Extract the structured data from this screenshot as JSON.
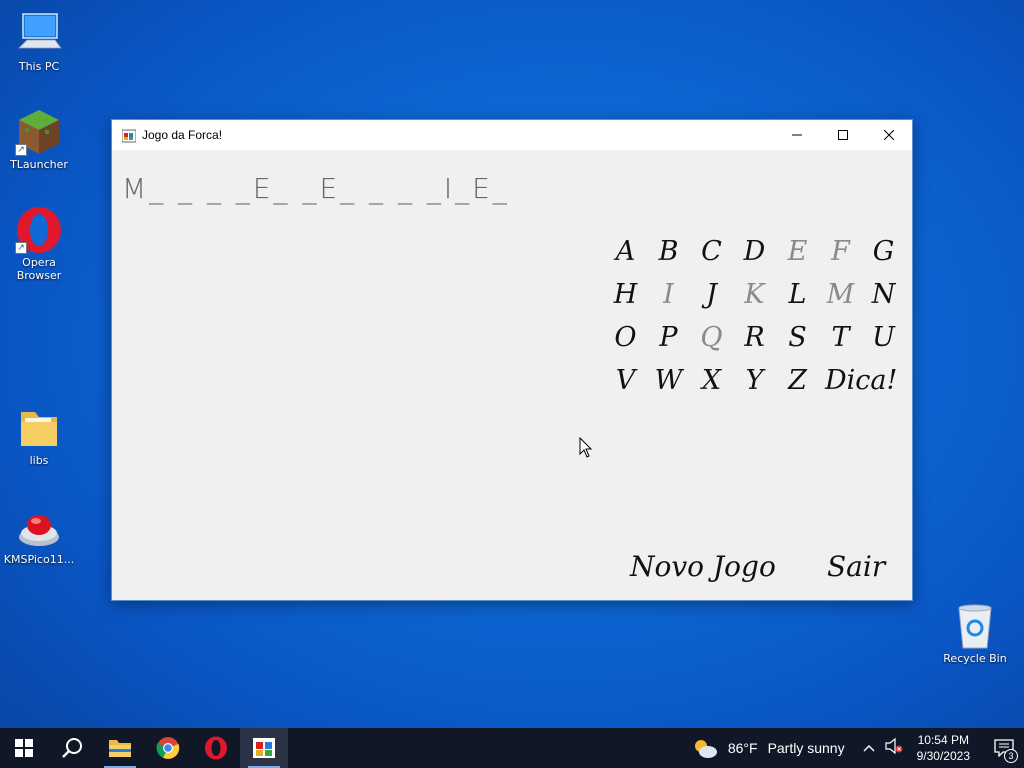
{
  "desktop": {
    "icons": [
      {
        "label": "This PC",
        "icon": "computer-icon"
      },
      {
        "label": "TLauncher",
        "icon": "minecraft-block-icon"
      },
      {
        "label": "Opera Browser",
        "icon": "opera-icon"
      },
      {
        "label": "libs",
        "icon": "folder-icon"
      },
      {
        "label": "KMSPico11...",
        "icon": "red-button-icon"
      },
      {
        "label": "Recycle Bin",
        "icon": "recycle-bin-icon"
      }
    ]
  },
  "window": {
    "title": "Jogo da Forca!",
    "word_display": "M_ _ _ _E_ _E_ _ _ _I_E_",
    "letters": [
      {
        "char": "A",
        "used": false
      },
      {
        "char": "B",
        "used": false
      },
      {
        "char": "C",
        "used": false
      },
      {
        "char": "D",
        "used": false
      },
      {
        "char": "E",
        "used": true
      },
      {
        "char": "F",
        "used": true
      },
      {
        "char": "G",
        "used": false
      },
      {
        "char": "H",
        "used": false
      },
      {
        "char": "I",
        "used": true
      },
      {
        "char": "J",
        "used": false
      },
      {
        "char": "K",
        "used": true
      },
      {
        "char": "L",
        "used": false
      },
      {
        "char": "M",
        "used": true
      },
      {
        "char": "N",
        "used": false
      },
      {
        "char": "O",
        "used": false
      },
      {
        "char": "P",
        "used": false
      },
      {
        "char": "Q",
        "used": true
      },
      {
        "char": "R",
        "used": false
      },
      {
        "char": "S",
        "used": false
      },
      {
        "char": "T",
        "used": false
      },
      {
        "char": "U",
        "used": false
      },
      {
        "char": "V",
        "used": false
      },
      {
        "char": "W",
        "used": false
      },
      {
        "char": "X",
        "used": false
      },
      {
        "char": "Y",
        "used": false
      },
      {
        "char": "Z",
        "used": false
      }
    ],
    "hint_label": "Dica!",
    "new_game_label": "Novo Jogo",
    "exit_label": "Sair"
  },
  "taskbar": {
    "apps": [
      {
        "name": "start",
        "icon": "windows-logo-icon"
      },
      {
        "name": "search",
        "icon": "search-icon"
      },
      {
        "name": "file-explorer",
        "icon": "folder-icon"
      },
      {
        "name": "chrome",
        "icon": "chrome-icon"
      },
      {
        "name": "opera",
        "icon": "opera-icon"
      },
      {
        "name": "jogo-da-forca",
        "icon": "app-window-icon"
      }
    ],
    "weather": {
      "temp": "86°F",
      "condition": "Partly sunny"
    },
    "clock": {
      "time": "10:54 PM",
      "date": "9/30/2023"
    },
    "notification_count": "3"
  },
  "colors": {
    "desktop_bg": "#0d6ad6",
    "taskbar_bg": "#101828",
    "window_bg": "#f0f0f0",
    "used_letter": "#8a8a8a"
  }
}
